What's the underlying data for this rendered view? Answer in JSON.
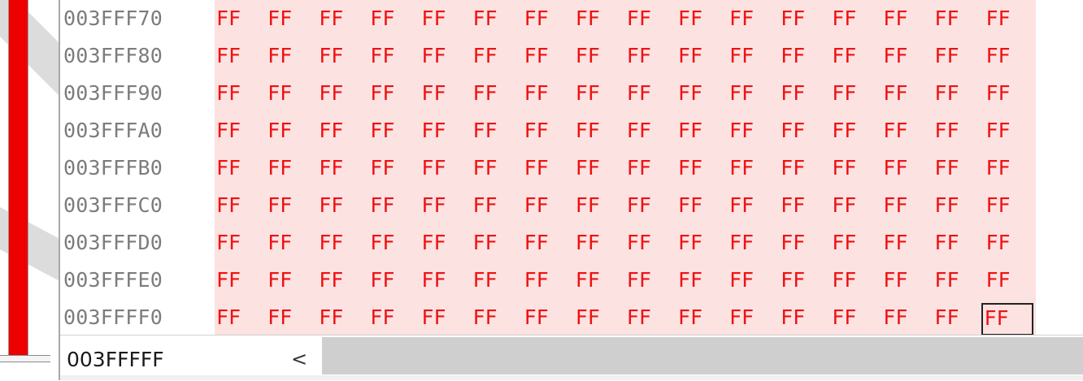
{
  "hex_view": {
    "rows": [
      {
        "address": "003FFF70",
        "bytes": [
          "FF",
          "FF",
          "FF",
          "FF",
          "FF",
          "FF",
          "FF",
          "FF",
          "FF",
          "FF",
          "FF",
          "FF",
          "FF",
          "FF",
          "FF",
          "FF"
        ]
      },
      {
        "address": "003FFF80",
        "bytes": [
          "FF",
          "FF",
          "FF",
          "FF",
          "FF",
          "FF",
          "FF",
          "FF",
          "FF",
          "FF",
          "FF",
          "FF",
          "FF",
          "FF",
          "FF",
          "FF"
        ]
      },
      {
        "address": "003FFF90",
        "bytes": [
          "FF",
          "FF",
          "FF",
          "FF",
          "FF",
          "FF",
          "FF",
          "FF",
          "FF",
          "FF",
          "FF",
          "FF",
          "FF",
          "FF",
          "FF",
          "FF"
        ]
      },
      {
        "address": "003FFFA0",
        "bytes": [
          "FF",
          "FF",
          "FF",
          "FF",
          "FF",
          "FF",
          "FF",
          "FF",
          "FF",
          "FF",
          "FF",
          "FF",
          "FF",
          "FF",
          "FF",
          "FF"
        ]
      },
      {
        "address": "003FFFB0",
        "bytes": [
          "FF",
          "FF",
          "FF",
          "FF",
          "FF",
          "FF",
          "FF",
          "FF",
          "FF",
          "FF",
          "FF",
          "FF",
          "FF",
          "FF",
          "FF",
          "FF"
        ]
      },
      {
        "address": "003FFFC0",
        "bytes": [
          "FF",
          "FF",
          "FF",
          "FF",
          "FF",
          "FF",
          "FF",
          "FF",
          "FF",
          "FF",
          "FF",
          "FF",
          "FF",
          "FF",
          "FF",
          "FF"
        ]
      },
      {
        "address": "003FFFD0",
        "bytes": [
          "FF",
          "FF",
          "FF",
          "FF",
          "FF",
          "FF",
          "FF",
          "FF",
          "FF",
          "FF",
          "FF",
          "FF",
          "FF",
          "FF",
          "FF",
          "FF"
        ]
      },
      {
        "address": "003FFFE0",
        "bytes": [
          "FF",
          "FF",
          "FF",
          "FF",
          "FF",
          "FF",
          "FF",
          "FF",
          "FF",
          "FF",
          "FF",
          "FF",
          "FF",
          "FF",
          "FF",
          "FF"
        ]
      },
      {
        "address": "003FFFF0",
        "bytes": [
          "FF",
          "FF",
          "FF",
          "FF",
          "FF",
          "FF",
          "FF",
          "FF",
          "FF",
          "FF",
          "FF",
          "FF",
          "FF",
          "FF",
          "FF",
          "FF"
        ]
      }
    ],
    "selected_row": 8,
    "selected_byte": 15
  },
  "status_bar": {
    "offset": "003FFFFF",
    "scroll_left_icon": "chevron-left-icon",
    "scroll_left_glyph": "<"
  },
  "colors": {
    "byte_text": "#ee1111",
    "byte_background": "#fde2e2",
    "address_text": "#7c7c7c",
    "overview_bar": "#ee0000"
  }
}
